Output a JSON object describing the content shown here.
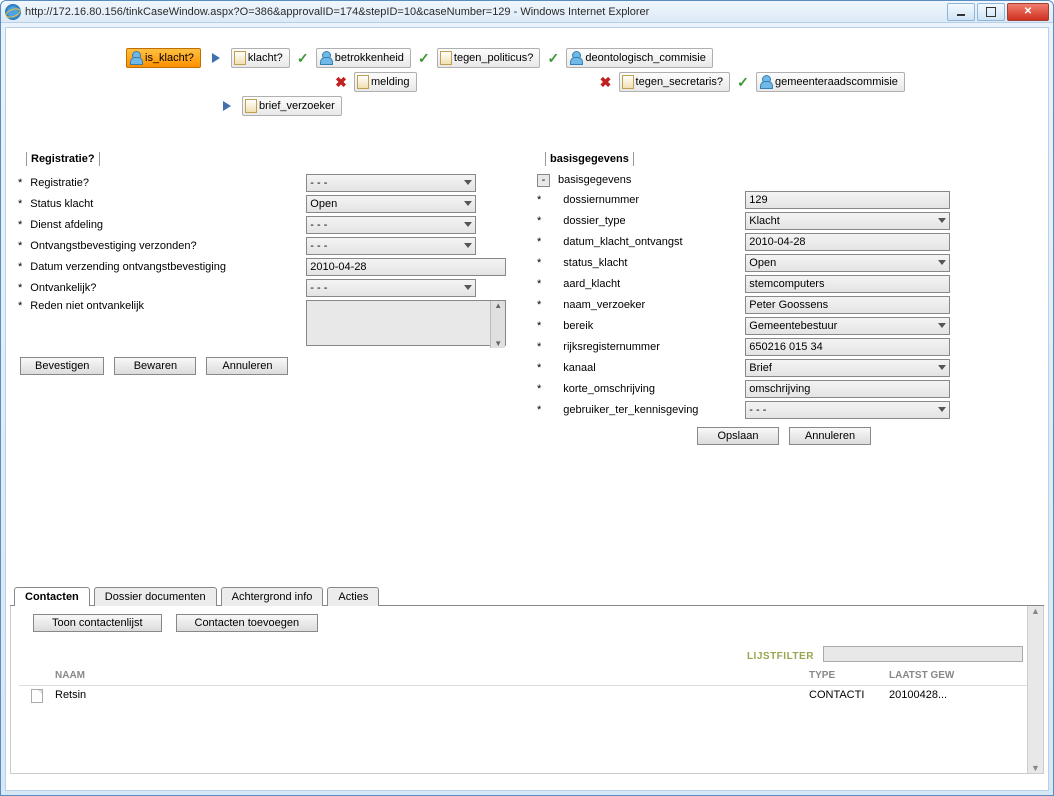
{
  "window": {
    "title": "http://172.16.80.156/tinkCaseWindow.aspx?O=386&approvalID=174&stepID=10&caseNumber=129 - Windows Internet Explorer"
  },
  "workflow": {
    "row1": [
      "is_klacht?",
      "klacht?",
      "betrokkenheid",
      "tegen_politicus?",
      "deontologisch_commisie"
    ],
    "row2_right": [
      "tegen_secretaris?",
      "gemeenteraadscommisie"
    ],
    "row2_left": "melding",
    "row3": "brief_verzoeker"
  },
  "left_panel": {
    "title": "Registratie?",
    "fields": {
      "registratie_label": "Registratie?",
      "registratie_value": "- - -",
      "status_label": "Status klacht",
      "status_value": "Open",
      "dienst_label": "Dienst afdeling",
      "dienst_value": "- - -",
      "ontvangst_label": "Ontvangstbevestiging verzonden?",
      "ontvangst_value": "- - -",
      "datum_label": "Datum verzending ontvangstbevestiging",
      "datum_value": "2010-04-28",
      "ontvankelijk_label": "Ontvankelijk?",
      "ontvankelijk_value": "- - -",
      "reden_label": "Reden niet ontvankelijk",
      "reden_value": ""
    },
    "buttons": {
      "confirm": "Bevestigen",
      "save": "Bewaren",
      "cancel": "Annuleren"
    }
  },
  "right_panel": {
    "title": "basisgegevens",
    "subtitle": "basisgegevens",
    "fields": {
      "dossiernummer_label": "dossiernummer",
      "dossiernummer_value": "129",
      "dossier_type_label": "dossier_type",
      "dossier_type_value": "Klacht",
      "datum_kl_label": "datum_klacht_ontvangst",
      "datum_kl_value": "2010-04-28",
      "status_label": "status_klacht",
      "status_value": "Open",
      "aard_label": "aard_klacht",
      "aard_value": "stemcomputers",
      "naam_label": "naam_verzoeker",
      "naam_value": "Peter Goossens",
      "bereik_label": "bereik",
      "bereik_value": "Gemeentebestuur",
      "rijks_label": "rijksregisternummer",
      "rijks_value": "650216 015 34",
      "kanaal_label": "kanaal",
      "kanaal_value": "Brief",
      "korte_label": "korte_omschrijving",
      "korte_value": "omschrijving",
      "gebruiker_label": "gebruiker_ter_kennisgeving",
      "gebruiker_value": "- - -"
    },
    "buttons": {
      "save": "Opslaan",
      "cancel": "Annuleren"
    }
  },
  "tabs": {
    "contacten": "Contacten",
    "documenten": "Dossier documenten",
    "achtergrond": "Achtergrond info",
    "acties": "Acties"
  },
  "contacts": {
    "show_list": "Toon contactenlijst",
    "add": "Contacten toevoegen",
    "filter_label": "LIJSTFILTER",
    "columns": {
      "naam": "NAAM",
      "type": "TYPE",
      "laatst": "LAATST GEW"
    },
    "rows": [
      {
        "naam": "Retsin",
        "type": "CONTACTI",
        "date": "20100428..."
      }
    ]
  }
}
